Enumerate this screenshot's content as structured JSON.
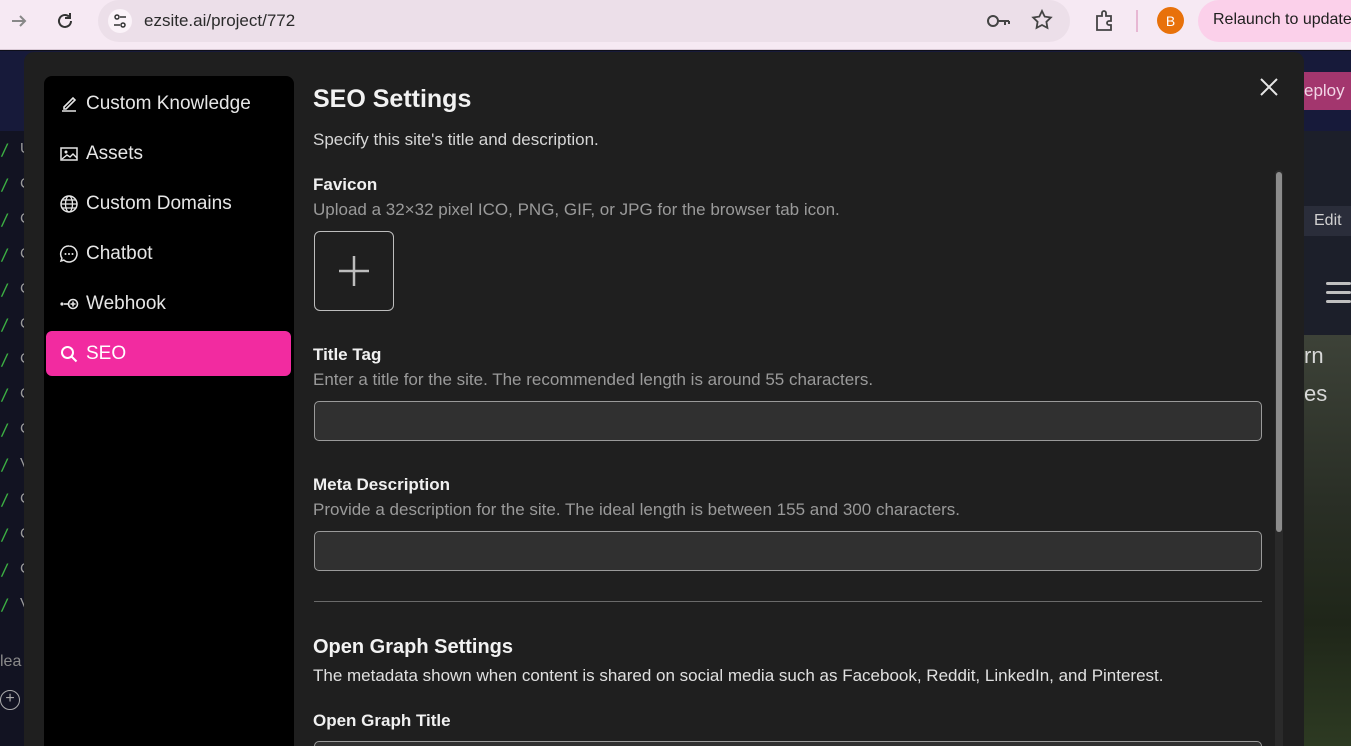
{
  "browser": {
    "url": "ezsite.ai/project/772",
    "profile_initial": "B",
    "relaunch_label": "Relaunch to update"
  },
  "background": {
    "deploy_label": "eploy",
    "edit_label": "Edit",
    "hero_text_1": "rn",
    "hero_text_2": "es",
    "bottom_text": "lea",
    "code_lines": [
      "U",
      "C",
      "C",
      "C",
      "C",
      "C",
      "C",
      "C",
      "C",
      "V",
      "C",
      "C",
      "C",
      "V"
    ]
  },
  "sidebar": {
    "items": [
      {
        "label": "Custom Knowledge",
        "icon": "pencil-icon"
      },
      {
        "label": "Assets",
        "icon": "image-icon"
      },
      {
        "label": "Custom Domains",
        "icon": "globe-icon"
      },
      {
        "label": "Chatbot",
        "icon": "chat-icon"
      },
      {
        "label": "Webhook",
        "icon": "webhook-icon"
      },
      {
        "label": "SEO",
        "icon": "search-icon",
        "active": true
      }
    ]
  },
  "seo": {
    "title": "SEO Settings",
    "subtitle": "Specify this site's title and description.",
    "favicon": {
      "label": "Favicon",
      "help": "Upload a 32×32 pixel ICO, PNG, GIF, or JPG for the browser tab icon."
    },
    "title_tag": {
      "label": "Title Tag",
      "help": "Enter a title for the site. The recommended length is around 55 characters.",
      "value": ""
    },
    "meta_description": {
      "label": "Meta Description",
      "help": "Provide a description for the site. The ideal length is between 155 and 300 characters.",
      "value": ""
    },
    "og": {
      "title": "Open Graph Settings",
      "subtitle": "The metadata shown when content is shared on social media such as Facebook, Reddit, LinkedIn, and Pinterest.",
      "og_title_label": "Open Graph Title"
    }
  },
  "colors": {
    "accent": "#f22ba0",
    "modal_bg": "#1f1f1f",
    "sidebar_bg": "#000000"
  }
}
